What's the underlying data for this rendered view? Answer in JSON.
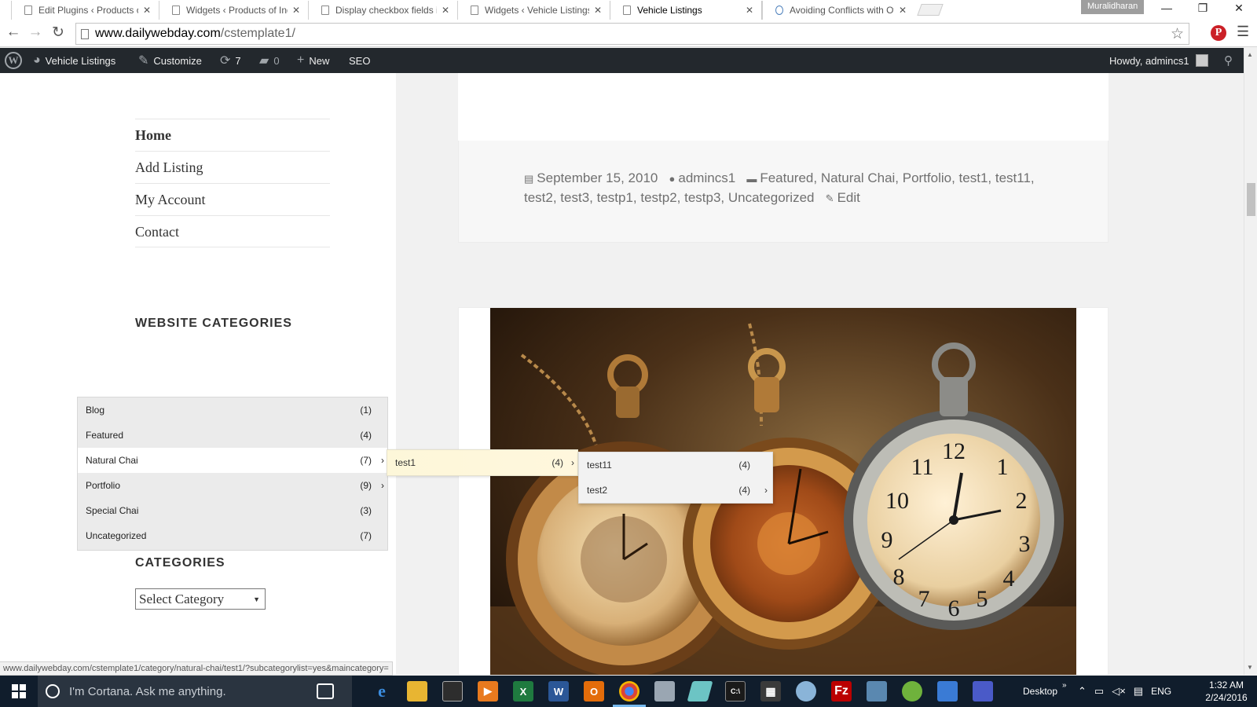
{
  "browser": {
    "tabs": [
      {
        "title": "Edit Plugins ‹ Products of I",
        "active": false
      },
      {
        "title": "Widgets ‹ Products of Indi",
        "active": false
      },
      {
        "title": "Display checkbox fields in",
        "active": false
      },
      {
        "title": "Widgets ‹ Vehicle Listings",
        "active": false
      },
      {
        "title": "Vehicle Listings",
        "active": true
      },
      {
        "title": "Avoiding Conflicts with Ot",
        "active": false
      }
    ],
    "profile_name": "Muralidharan",
    "url_host": "www.dailywebday.com",
    "url_path": "/cstemplate1/",
    "status_url": "www.dailywebday.com/cstemplate1/category/natural-chai/test1/?subcategorylist=yes&maincategory="
  },
  "adminbar": {
    "site_name": "Vehicle Listings",
    "customize": "Customize",
    "updates_count": "7",
    "comments_count": "0",
    "new_label": "New",
    "seo_label": "SEO",
    "howdy": "Howdy, admincs1"
  },
  "sidebar": {
    "menu": [
      "Home",
      "Add Listing",
      "My Account",
      "Contact"
    ],
    "website_categories_title": "WEBSITE CATEGORIES",
    "categories": [
      {
        "name": "Blog",
        "count": "(1)",
        "arrow": ""
      },
      {
        "name": "Featured",
        "count": "(4)",
        "arrow": ""
      },
      {
        "name": "Natural Chai",
        "count": "(7)",
        "arrow": "›"
      },
      {
        "name": "Portfolio",
        "count": "(9)",
        "arrow": "›"
      },
      {
        "name": "Special Chai",
        "count": "(3)",
        "arrow": ""
      },
      {
        "name": "Uncategorized",
        "count": "(7)",
        "arrow": ""
      }
    ],
    "submenu_level1": {
      "name": "test1",
      "count": "(4)",
      "arrow": "›"
    },
    "submenu_level2": [
      {
        "name": "test11",
        "count": "(4)",
        "arrow": ""
      },
      {
        "name": "test2",
        "count": "(4)",
        "arrow": "›"
      }
    ],
    "categories_title": "CATEGORIES",
    "select_category": "Select Category"
  },
  "post": {
    "date": "September 15, 2010",
    "author": "admincs1",
    "categories": "Featured, Natural Chai, Portfolio, test1, test11, test2, test3, testp1, testp2, testp3, Uncategorized",
    "edit": "Edit"
  },
  "taskbar": {
    "cortana_placeholder": "I'm Cortana. Ask me anything.",
    "desktop_label": "Desktop",
    "lang": "ENG",
    "time": "1:32 AM",
    "date": "2/24/2016"
  },
  "colors": {
    "adminbar_bg": "#23282d",
    "taskbar_bg": "#101d2c",
    "submenu_highlight": "#fdf7d9"
  }
}
